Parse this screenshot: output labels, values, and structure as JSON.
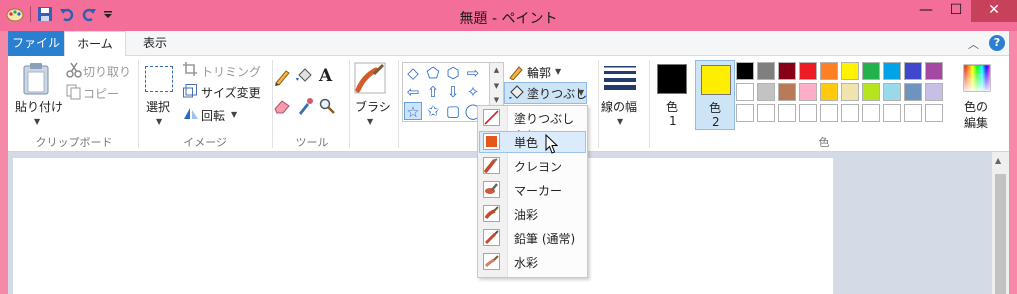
{
  "window": {
    "title": "無題 - ペイント",
    "controls": {
      "minimize": "—",
      "maximize": "☐",
      "close": "✕"
    }
  },
  "tabs": [
    {
      "label": "ファイル"
    },
    {
      "label": "ホーム"
    },
    {
      "label": "表示"
    }
  ],
  "clipboard": {
    "paste": "貼り付け",
    "cut": "切り取り",
    "copy": "コピー",
    "group": "クリップボード"
  },
  "image": {
    "select": "選択",
    "crop": "トリミング",
    "resize": "サイズ変更",
    "rotate": "回転",
    "group": "イメージ"
  },
  "tools": {
    "group": "ツール"
  },
  "brushes": {
    "label": "ブラシ"
  },
  "shapes": {
    "items": [
      "◇",
      "⬠",
      "⬡",
      "⇨",
      "⇦",
      "⇧",
      "⇩",
      "✧",
      "☆",
      "✩",
      "▢",
      "◯"
    ],
    "outline": "輪郭",
    "fill": "塗りつぶし"
  },
  "size": {
    "label": "線の幅"
  },
  "colors": {
    "color1": {
      "line1": "色",
      "line2": "1",
      "value": "#000000"
    },
    "color2": {
      "line1": "色",
      "line2": "2",
      "value": "#ffee00"
    },
    "edit": {
      "line1": "色の",
      "line2": "編集"
    },
    "group": "色",
    "palette_row1": [
      "#000000",
      "#7f7f7f",
      "#880015",
      "#ed1c24",
      "#ff7f27",
      "#fff200",
      "#22b14c",
      "#00a2e8",
      "#3f48cc",
      "#a349a4"
    ],
    "palette_row2": [
      "#ffffff",
      "#c3c3c3",
      "#b97a57",
      "#ffaec9",
      "#ffc90e",
      "#efe4b0",
      "#b5e61d",
      "#99d9ea",
      "#7092be",
      "#c8bfe7"
    ],
    "palette_row3": [
      "#ffffff",
      "#ffffff",
      "#ffffff",
      "#ffffff",
      "#ffffff",
      "#ffffff",
      "#ffffff",
      "#ffffff",
      "#ffffff",
      "#ffffff"
    ]
  },
  "fill_menu": {
    "items": [
      {
        "label": "塗りつぶしなし",
        "icon": "no-fill-icon"
      },
      {
        "label": "単色",
        "icon": "solid-color-icon",
        "hovered": true
      },
      {
        "label": "クレヨン",
        "icon": "crayon-icon"
      },
      {
        "label": "マーカー",
        "icon": "marker-icon"
      },
      {
        "label": "油彩",
        "icon": "oil-paint-icon"
      },
      {
        "label": "鉛筆 (通常)",
        "icon": "pencil-icon"
      },
      {
        "label": "水彩",
        "icon": "watercolor-icon"
      }
    ]
  }
}
